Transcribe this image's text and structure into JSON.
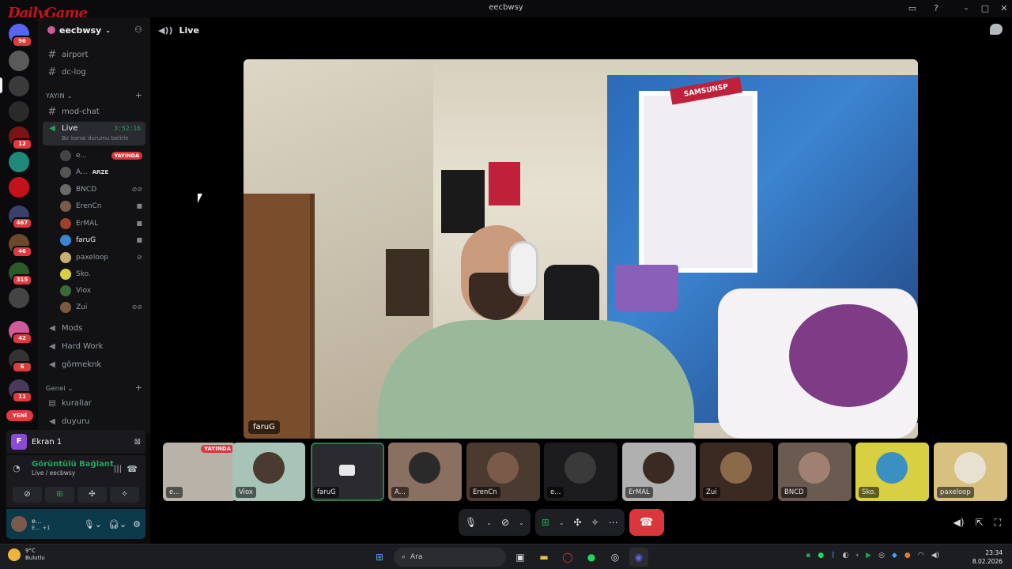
{
  "window": {
    "title": "eecbwsy"
  },
  "rail": {
    "badges": [
      "96",
      "12",
      "467",
      "46",
      "315",
      "42",
      "6",
      "11"
    ],
    "new_label": "YENİ"
  },
  "sidebar": {
    "guild_name": "eecbwsy",
    "channels_top": [
      "airport",
      "dc-log"
    ],
    "category_yayin": "YAYIN",
    "mod_chat": "mod-chat",
    "live_channel": {
      "name": "Live",
      "time": "3:52:16",
      "status": "Bir kanal durumu belirle"
    },
    "voice_users": [
      {
        "name": "e...",
        "tag": "YAYINDA"
      },
      {
        "name": "A...",
        "tag": "ARZE"
      },
      {
        "name": "BNCD"
      },
      {
        "name": "ErenCn"
      },
      {
        "name": "ErMAL"
      },
      {
        "name": "faruG"
      },
      {
        "name": "paxeloop"
      },
      {
        "name": "Sko."
      },
      {
        "name": "Viox"
      },
      {
        "name": "Zui"
      }
    ],
    "voice_channels": [
      "Mods",
      "Hard Work",
      "görmeknk"
    ],
    "category_genel": "Genel",
    "genel_channels": [
      "kurallar",
      "duyuru"
    ]
  },
  "screen_panel": {
    "avatar_letter": "F",
    "label": "Ekran 1"
  },
  "voice_panel": {
    "status": "Görüntülü Bağlant",
    "sub": "Live / eecbwsy"
  },
  "user_panel": {
    "name_line1": "e...",
    "name_line2": "E... +1"
  },
  "main": {
    "channel_title": "Live"
  },
  "stage": {
    "name": "faruG",
    "sign_text": "SAMSUNSP"
  },
  "tiles": [
    {
      "name": "e...",
      "live": "YAYINDA"
    },
    {
      "name": "Viox"
    },
    {
      "name": "faruG"
    },
    {
      "name": "A..."
    },
    {
      "name": "ErenCn"
    },
    {
      "name": "e..."
    },
    {
      "name": "ErMAL"
    },
    {
      "name": "Zui"
    },
    {
      "name": "BNCD"
    },
    {
      "name": "Sko."
    },
    {
      "name": "paxeloop"
    }
  ],
  "taskbar": {
    "temp": "9°C",
    "weather": "Bulutlu",
    "search_placeholder": "Ara",
    "time": "23:34",
    "date": "8.02.2026"
  },
  "watermark": "DailyGame"
}
